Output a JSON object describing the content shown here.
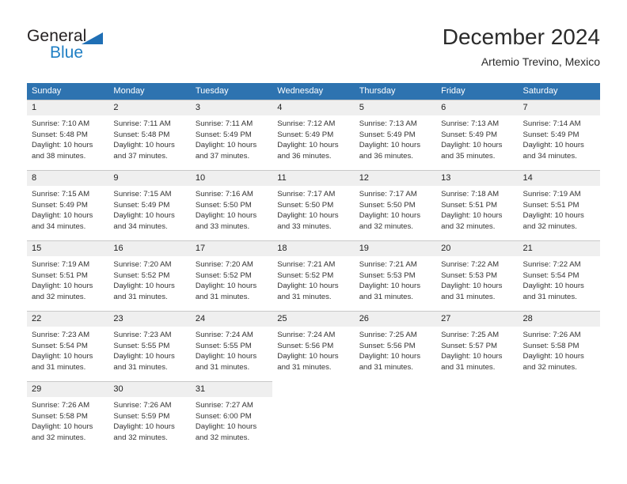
{
  "brand": {
    "name_part1": "General",
    "name_part2": "Blue",
    "triangle_color": "#1f6fb5",
    "blue_color": "#1f7fc4"
  },
  "header": {
    "title": "December 2024",
    "subtitle": "Artemio Trevino, Mexico"
  },
  "colors": {
    "header_row_bg": "#2e73b0",
    "header_row_text": "#ffffff",
    "daynum_bg": "#efefef",
    "cell_border": "#c8c8c8",
    "body_text": "#333333"
  },
  "weekday_headers": [
    "Sunday",
    "Monday",
    "Tuesday",
    "Wednesday",
    "Thursday",
    "Friday",
    "Saturday"
  ],
  "weeks": [
    [
      {
        "day": "1",
        "sunrise": "Sunrise: 7:10 AM",
        "sunset": "Sunset: 5:48 PM",
        "daylight_line1": "Daylight: 10 hours",
        "daylight_line2": "and 38 minutes."
      },
      {
        "day": "2",
        "sunrise": "Sunrise: 7:11 AM",
        "sunset": "Sunset: 5:48 PM",
        "daylight_line1": "Daylight: 10 hours",
        "daylight_line2": "and 37 minutes."
      },
      {
        "day": "3",
        "sunrise": "Sunrise: 7:11 AM",
        "sunset": "Sunset: 5:49 PM",
        "daylight_line1": "Daylight: 10 hours",
        "daylight_line2": "and 37 minutes."
      },
      {
        "day": "4",
        "sunrise": "Sunrise: 7:12 AM",
        "sunset": "Sunset: 5:49 PM",
        "daylight_line1": "Daylight: 10 hours",
        "daylight_line2": "and 36 minutes."
      },
      {
        "day": "5",
        "sunrise": "Sunrise: 7:13 AM",
        "sunset": "Sunset: 5:49 PM",
        "daylight_line1": "Daylight: 10 hours",
        "daylight_line2": "and 36 minutes."
      },
      {
        "day": "6",
        "sunrise": "Sunrise: 7:13 AM",
        "sunset": "Sunset: 5:49 PM",
        "daylight_line1": "Daylight: 10 hours",
        "daylight_line2": "and 35 minutes."
      },
      {
        "day": "7",
        "sunrise": "Sunrise: 7:14 AM",
        "sunset": "Sunset: 5:49 PM",
        "daylight_line1": "Daylight: 10 hours",
        "daylight_line2": "and 34 minutes."
      }
    ],
    [
      {
        "day": "8",
        "sunrise": "Sunrise: 7:15 AM",
        "sunset": "Sunset: 5:49 PM",
        "daylight_line1": "Daylight: 10 hours",
        "daylight_line2": "and 34 minutes."
      },
      {
        "day": "9",
        "sunrise": "Sunrise: 7:15 AM",
        "sunset": "Sunset: 5:49 PM",
        "daylight_line1": "Daylight: 10 hours",
        "daylight_line2": "and 34 minutes."
      },
      {
        "day": "10",
        "sunrise": "Sunrise: 7:16 AM",
        "sunset": "Sunset: 5:50 PM",
        "daylight_line1": "Daylight: 10 hours",
        "daylight_line2": "and 33 minutes."
      },
      {
        "day": "11",
        "sunrise": "Sunrise: 7:17 AM",
        "sunset": "Sunset: 5:50 PM",
        "daylight_line1": "Daylight: 10 hours",
        "daylight_line2": "and 33 minutes."
      },
      {
        "day": "12",
        "sunrise": "Sunrise: 7:17 AM",
        "sunset": "Sunset: 5:50 PM",
        "daylight_line1": "Daylight: 10 hours",
        "daylight_line2": "and 32 minutes."
      },
      {
        "day": "13",
        "sunrise": "Sunrise: 7:18 AM",
        "sunset": "Sunset: 5:51 PM",
        "daylight_line1": "Daylight: 10 hours",
        "daylight_line2": "and 32 minutes."
      },
      {
        "day": "14",
        "sunrise": "Sunrise: 7:19 AM",
        "sunset": "Sunset: 5:51 PM",
        "daylight_line1": "Daylight: 10 hours",
        "daylight_line2": "and 32 minutes."
      }
    ],
    [
      {
        "day": "15",
        "sunrise": "Sunrise: 7:19 AM",
        "sunset": "Sunset: 5:51 PM",
        "daylight_line1": "Daylight: 10 hours",
        "daylight_line2": "and 32 minutes."
      },
      {
        "day": "16",
        "sunrise": "Sunrise: 7:20 AM",
        "sunset": "Sunset: 5:52 PM",
        "daylight_line1": "Daylight: 10 hours",
        "daylight_line2": "and 31 minutes."
      },
      {
        "day": "17",
        "sunrise": "Sunrise: 7:20 AM",
        "sunset": "Sunset: 5:52 PM",
        "daylight_line1": "Daylight: 10 hours",
        "daylight_line2": "and 31 minutes."
      },
      {
        "day": "18",
        "sunrise": "Sunrise: 7:21 AM",
        "sunset": "Sunset: 5:52 PM",
        "daylight_line1": "Daylight: 10 hours",
        "daylight_line2": "and 31 minutes."
      },
      {
        "day": "19",
        "sunrise": "Sunrise: 7:21 AM",
        "sunset": "Sunset: 5:53 PM",
        "daylight_line1": "Daylight: 10 hours",
        "daylight_line2": "and 31 minutes."
      },
      {
        "day": "20",
        "sunrise": "Sunrise: 7:22 AM",
        "sunset": "Sunset: 5:53 PM",
        "daylight_line1": "Daylight: 10 hours",
        "daylight_line2": "and 31 minutes."
      },
      {
        "day": "21",
        "sunrise": "Sunrise: 7:22 AM",
        "sunset": "Sunset: 5:54 PM",
        "daylight_line1": "Daylight: 10 hours",
        "daylight_line2": "and 31 minutes."
      }
    ],
    [
      {
        "day": "22",
        "sunrise": "Sunrise: 7:23 AM",
        "sunset": "Sunset: 5:54 PM",
        "daylight_line1": "Daylight: 10 hours",
        "daylight_line2": "and 31 minutes."
      },
      {
        "day": "23",
        "sunrise": "Sunrise: 7:23 AM",
        "sunset": "Sunset: 5:55 PM",
        "daylight_line1": "Daylight: 10 hours",
        "daylight_line2": "and 31 minutes."
      },
      {
        "day": "24",
        "sunrise": "Sunrise: 7:24 AM",
        "sunset": "Sunset: 5:55 PM",
        "daylight_line1": "Daylight: 10 hours",
        "daylight_line2": "and 31 minutes."
      },
      {
        "day": "25",
        "sunrise": "Sunrise: 7:24 AM",
        "sunset": "Sunset: 5:56 PM",
        "daylight_line1": "Daylight: 10 hours",
        "daylight_line2": "and 31 minutes."
      },
      {
        "day": "26",
        "sunrise": "Sunrise: 7:25 AM",
        "sunset": "Sunset: 5:56 PM",
        "daylight_line1": "Daylight: 10 hours",
        "daylight_line2": "and 31 minutes."
      },
      {
        "day": "27",
        "sunrise": "Sunrise: 7:25 AM",
        "sunset": "Sunset: 5:57 PM",
        "daylight_line1": "Daylight: 10 hours",
        "daylight_line2": "and 31 minutes."
      },
      {
        "day": "28",
        "sunrise": "Sunrise: 7:26 AM",
        "sunset": "Sunset: 5:58 PM",
        "daylight_line1": "Daylight: 10 hours",
        "daylight_line2": "and 32 minutes."
      }
    ],
    [
      {
        "day": "29",
        "sunrise": "Sunrise: 7:26 AM",
        "sunset": "Sunset: 5:58 PM",
        "daylight_line1": "Daylight: 10 hours",
        "daylight_line2": "and 32 minutes."
      },
      {
        "day": "30",
        "sunrise": "Sunrise: 7:26 AM",
        "sunset": "Sunset: 5:59 PM",
        "daylight_line1": "Daylight: 10 hours",
        "daylight_line2": "and 32 minutes."
      },
      {
        "day": "31",
        "sunrise": "Sunrise: 7:27 AM",
        "sunset": "Sunset: 6:00 PM",
        "daylight_line1": "Daylight: 10 hours",
        "daylight_line2": "and 32 minutes."
      },
      {
        "day": "",
        "sunrise": "",
        "sunset": "",
        "daylight_line1": "",
        "daylight_line2": ""
      },
      {
        "day": "",
        "sunrise": "",
        "sunset": "",
        "daylight_line1": "",
        "daylight_line2": ""
      },
      {
        "day": "",
        "sunrise": "",
        "sunset": "",
        "daylight_line1": "",
        "daylight_line2": ""
      },
      {
        "day": "",
        "sunrise": "",
        "sunset": "",
        "daylight_line1": "",
        "daylight_line2": ""
      }
    ]
  ]
}
